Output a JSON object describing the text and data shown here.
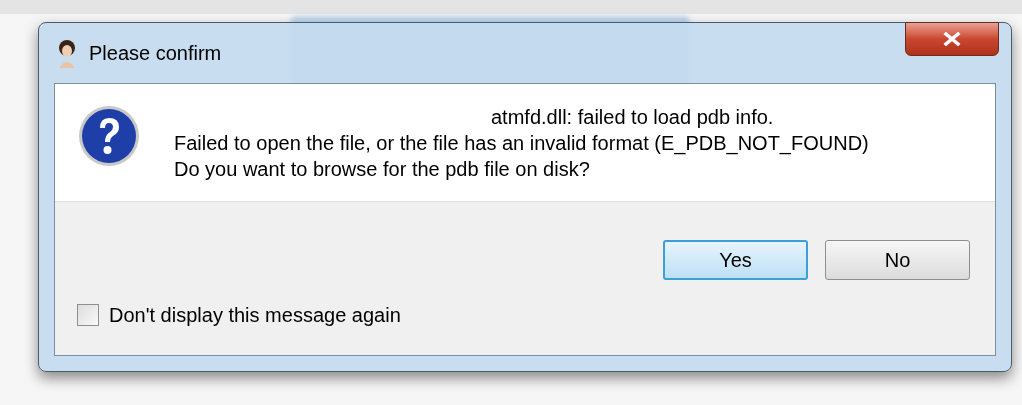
{
  "window": {
    "title": "Please confirm"
  },
  "message": {
    "heading": "atmfd.dll: failed to load pdb info.",
    "lines": [
      "Failed to open the file, or the file has an invalid format (E_PDB_NOT_FOUND)",
      "Do you want to browse for the pdb file on disk?"
    ]
  },
  "buttons": [
    {
      "label": "Yes",
      "default": true
    },
    {
      "label": "No",
      "default": false
    }
  ],
  "checkbox": {
    "label": "Don't display this message again",
    "checked": false
  }
}
